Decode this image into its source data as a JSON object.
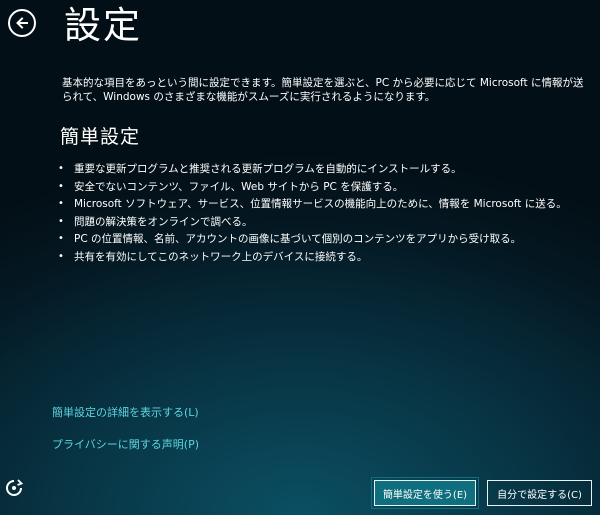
{
  "page": {
    "title": "設定",
    "intro": "基本的な項目をあっという間に設定できます。簡単設定を選ぶと、PC から必要に応じて Microsoft に情報が送られて、Windows のさまざまな機能がスムーズに実行されるようになります。"
  },
  "express": {
    "heading": "簡単設定",
    "items": [
      "重要な更新プログラムと推奨される更新プログラムを自動的にインストールする。",
      "安全でないコンテンツ、ファイル、Web サイトから PC を保護する。",
      "Microsoft ソフトウェア、サービス、位置情報サービスの機能向上のために、情報を Microsoft に送る。",
      "問題の解決策をオンラインで調べる。",
      "PC の位置情報、名前、アカウントの画像に基づいて個別のコンテンツをアプリから受け取る。",
      "共有を有効にしてこのネットワーク上のデバイスに接続する。"
    ],
    "bullet": "•"
  },
  "links": {
    "details": "簡単設定の詳細を表示する(L)",
    "privacy": "プライバシーに関する声明(P)"
  },
  "buttons": {
    "express": "簡単設定を使う(E)",
    "customize": "自分で設定する(C)"
  },
  "icons": {
    "back": "back-arrow-icon",
    "ease_of_access": "ease-of-access-icon"
  },
  "colors": {
    "link": "#5fd4e0",
    "button_primary": "#0f6f7e"
  }
}
